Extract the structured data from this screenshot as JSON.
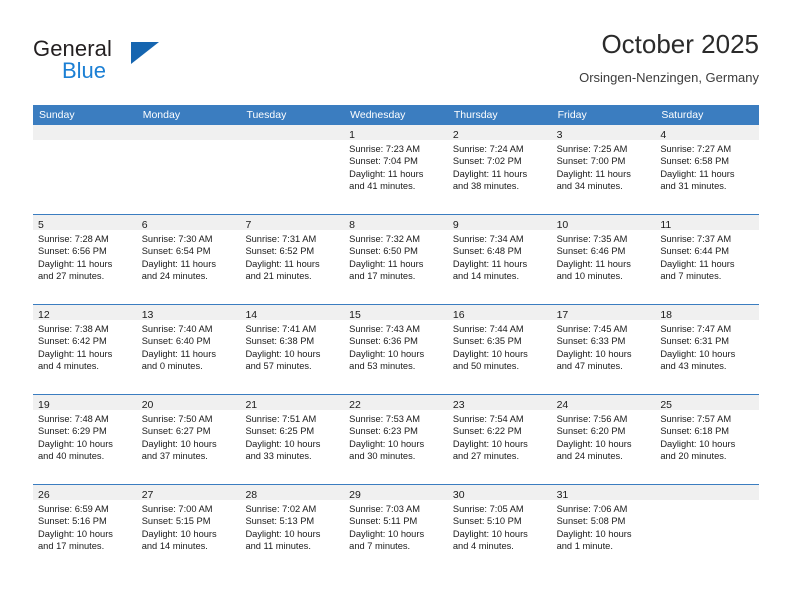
{
  "brand": {
    "word_one": "General",
    "word_two": "Blue",
    "triangle_icon": "brand-triangle-icon"
  },
  "header": {
    "month_title": "October 2025",
    "location": "Orsingen-Nenzingen, Germany"
  },
  "colors": {
    "header_blue": "#3b7dc0",
    "brand_blue": "#1b7fd4",
    "brand_triangle": "#1565b0",
    "day_band": "#f0f0f0",
    "text": "#1a1a1a"
  },
  "calendar": {
    "day_names": [
      "Sunday",
      "Monday",
      "Tuesday",
      "Wednesday",
      "Thursday",
      "Friday",
      "Saturday"
    ],
    "weeks": [
      [
        {
          "day": "",
          "lines": []
        },
        {
          "day": "",
          "lines": []
        },
        {
          "day": "",
          "lines": []
        },
        {
          "day": "1",
          "lines": [
            "Sunrise: 7:23 AM",
            "Sunset: 7:04 PM",
            "Daylight: 11 hours",
            "and 41 minutes."
          ]
        },
        {
          "day": "2",
          "lines": [
            "Sunrise: 7:24 AM",
            "Sunset: 7:02 PM",
            "Daylight: 11 hours",
            "and 38 minutes."
          ]
        },
        {
          "day": "3",
          "lines": [
            "Sunrise: 7:25 AM",
            "Sunset: 7:00 PM",
            "Daylight: 11 hours",
            "and 34 minutes."
          ]
        },
        {
          "day": "4",
          "lines": [
            "Sunrise: 7:27 AM",
            "Sunset: 6:58 PM",
            "Daylight: 11 hours",
            "and 31 minutes."
          ]
        }
      ],
      [
        {
          "day": "5",
          "lines": [
            "Sunrise: 7:28 AM",
            "Sunset: 6:56 PM",
            "Daylight: 11 hours",
            "and 27 minutes."
          ]
        },
        {
          "day": "6",
          "lines": [
            "Sunrise: 7:30 AM",
            "Sunset: 6:54 PM",
            "Daylight: 11 hours",
            "and 24 minutes."
          ]
        },
        {
          "day": "7",
          "lines": [
            "Sunrise: 7:31 AM",
            "Sunset: 6:52 PM",
            "Daylight: 11 hours",
            "and 21 minutes."
          ]
        },
        {
          "day": "8",
          "lines": [
            "Sunrise: 7:32 AM",
            "Sunset: 6:50 PM",
            "Daylight: 11 hours",
            "and 17 minutes."
          ]
        },
        {
          "day": "9",
          "lines": [
            "Sunrise: 7:34 AM",
            "Sunset: 6:48 PM",
            "Daylight: 11 hours",
            "and 14 minutes."
          ]
        },
        {
          "day": "10",
          "lines": [
            "Sunrise: 7:35 AM",
            "Sunset: 6:46 PM",
            "Daylight: 11 hours",
            "and 10 minutes."
          ]
        },
        {
          "day": "11",
          "lines": [
            "Sunrise: 7:37 AM",
            "Sunset: 6:44 PM",
            "Daylight: 11 hours",
            "and 7 minutes."
          ]
        }
      ],
      [
        {
          "day": "12",
          "lines": [
            "Sunrise: 7:38 AM",
            "Sunset: 6:42 PM",
            "Daylight: 11 hours",
            "and 4 minutes."
          ]
        },
        {
          "day": "13",
          "lines": [
            "Sunrise: 7:40 AM",
            "Sunset: 6:40 PM",
            "Daylight: 11 hours",
            "and 0 minutes."
          ]
        },
        {
          "day": "14",
          "lines": [
            "Sunrise: 7:41 AM",
            "Sunset: 6:38 PM",
            "Daylight: 10 hours",
            "and 57 minutes."
          ]
        },
        {
          "day": "15",
          "lines": [
            "Sunrise: 7:43 AM",
            "Sunset: 6:36 PM",
            "Daylight: 10 hours",
            "and 53 minutes."
          ]
        },
        {
          "day": "16",
          "lines": [
            "Sunrise: 7:44 AM",
            "Sunset: 6:35 PM",
            "Daylight: 10 hours",
            "and 50 minutes."
          ]
        },
        {
          "day": "17",
          "lines": [
            "Sunrise: 7:45 AM",
            "Sunset: 6:33 PM",
            "Daylight: 10 hours",
            "and 47 minutes."
          ]
        },
        {
          "day": "18",
          "lines": [
            "Sunrise: 7:47 AM",
            "Sunset: 6:31 PM",
            "Daylight: 10 hours",
            "and 43 minutes."
          ]
        }
      ],
      [
        {
          "day": "19",
          "lines": [
            "Sunrise: 7:48 AM",
            "Sunset: 6:29 PM",
            "Daylight: 10 hours",
            "and 40 minutes."
          ]
        },
        {
          "day": "20",
          "lines": [
            "Sunrise: 7:50 AM",
            "Sunset: 6:27 PM",
            "Daylight: 10 hours",
            "and 37 minutes."
          ]
        },
        {
          "day": "21",
          "lines": [
            "Sunrise: 7:51 AM",
            "Sunset: 6:25 PM",
            "Daylight: 10 hours",
            "and 33 minutes."
          ]
        },
        {
          "day": "22",
          "lines": [
            "Sunrise: 7:53 AM",
            "Sunset: 6:23 PM",
            "Daylight: 10 hours",
            "and 30 minutes."
          ]
        },
        {
          "day": "23",
          "lines": [
            "Sunrise: 7:54 AM",
            "Sunset: 6:22 PM",
            "Daylight: 10 hours",
            "and 27 minutes."
          ]
        },
        {
          "day": "24",
          "lines": [
            "Sunrise: 7:56 AM",
            "Sunset: 6:20 PM",
            "Daylight: 10 hours",
            "and 24 minutes."
          ]
        },
        {
          "day": "25",
          "lines": [
            "Sunrise: 7:57 AM",
            "Sunset: 6:18 PM",
            "Daylight: 10 hours",
            "and 20 minutes."
          ]
        }
      ],
      [
        {
          "day": "26",
          "lines": [
            "Sunrise: 6:59 AM",
            "Sunset: 5:16 PM",
            "Daylight: 10 hours",
            "and 17 minutes."
          ]
        },
        {
          "day": "27",
          "lines": [
            "Sunrise: 7:00 AM",
            "Sunset: 5:15 PM",
            "Daylight: 10 hours",
            "and 14 minutes."
          ]
        },
        {
          "day": "28",
          "lines": [
            "Sunrise: 7:02 AM",
            "Sunset: 5:13 PM",
            "Daylight: 10 hours",
            "and 11 minutes."
          ]
        },
        {
          "day": "29",
          "lines": [
            "Sunrise: 7:03 AM",
            "Sunset: 5:11 PM",
            "Daylight: 10 hours",
            "and 7 minutes."
          ]
        },
        {
          "day": "30",
          "lines": [
            "Sunrise: 7:05 AM",
            "Sunset: 5:10 PM",
            "Daylight: 10 hours",
            "and 4 minutes."
          ]
        },
        {
          "day": "31",
          "lines": [
            "Sunrise: 7:06 AM",
            "Sunset: 5:08 PM",
            "Daylight: 10 hours",
            "and 1 minute."
          ]
        },
        {
          "day": "",
          "lines": []
        }
      ]
    ]
  }
}
